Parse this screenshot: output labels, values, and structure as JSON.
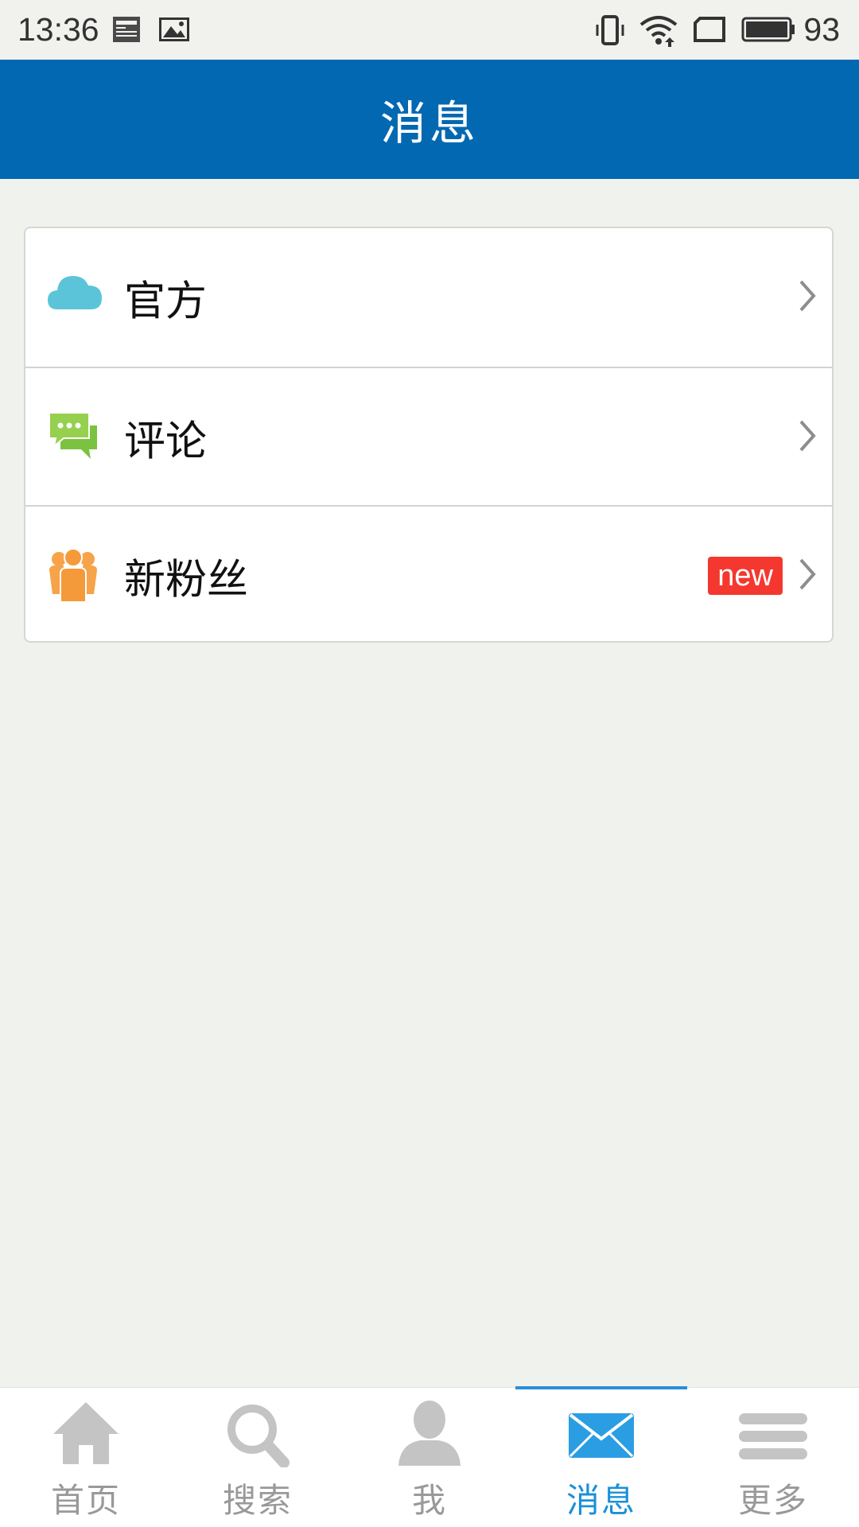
{
  "status_bar": {
    "time": "13:36",
    "battery_level": "93",
    "icons": [
      "news-notification-icon",
      "image-notification-icon",
      "vibrate-icon",
      "wifi-icon",
      "sim-card-icon",
      "battery-icon"
    ]
  },
  "header": {
    "title": "消息"
  },
  "messages": {
    "items": [
      {
        "label": "官方",
        "icon": "cloud-icon"
      },
      {
        "label": "评论",
        "icon": "chat-bubbles-icon"
      },
      {
        "label": "新粉丝",
        "icon": "followers-icon",
        "badge": "new"
      }
    ]
  },
  "bottom_nav": {
    "items": [
      {
        "label": "首页",
        "icon": "home-icon"
      },
      {
        "label": "搜索",
        "icon": "search-icon"
      },
      {
        "label": "我",
        "icon": "user-icon"
      },
      {
        "label": "消息",
        "icon": "mail-icon",
        "active": true
      },
      {
        "label": "更多",
        "icon": "menu-icon"
      }
    ]
  },
  "colors": {
    "header_bg": "#0268b2",
    "page_bg": "#f0f2ed",
    "active_tab": "#1a90d9",
    "badge_bg": "#f4382f"
  }
}
